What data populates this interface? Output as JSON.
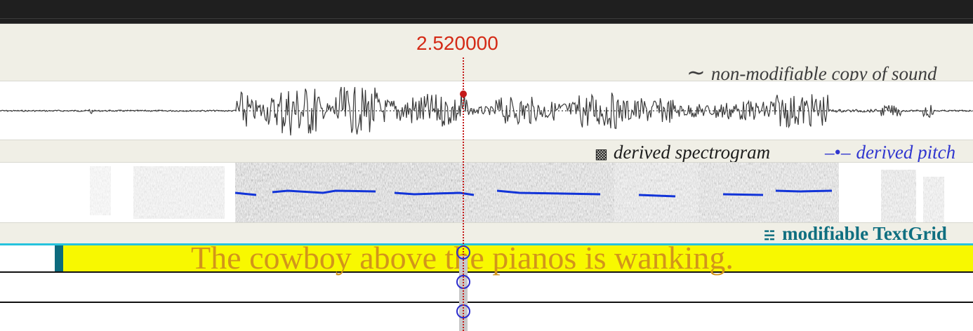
{
  "cursor": {
    "time": "2.520000"
  },
  "sound": {
    "icon": "waveform-icon",
    "glyph": "∼",
    "label": "non-modifiable copy of sound"
  },
  "spectrogram": {
    "icon": "spectrogram-icon",
    "glyph": "▩",
    "label": "derived spectrogram"
  },
  "pitch": {
    "icon": "pitch-icon",
    "glyph": "–•–",
    "label": "derived pitch"
  },
  "textgrid": {
    "icon": "tier-list-icon",
    "glyph": "☵",
    "label": "modifiable TextGrid",
    "tiers": [
      {
        "intervals": [
          "",
          "The cowboy above the pianos is wanking."
        ]
      },
      {
        "intervals": [
          ""
        ]
      },
      {
        "intervals": [
          ""
        ]
      }
    ]
  },
  "colors": {
    "cursor": "#d42a16",
    "pitch": "#3036cf",
    "textgrid": "#0f6f80",
    "selected_interval": "#f8f800",
    "interval_text": "#d2951a",
    "tier_highlight": "#26c3dd"
  }
}
